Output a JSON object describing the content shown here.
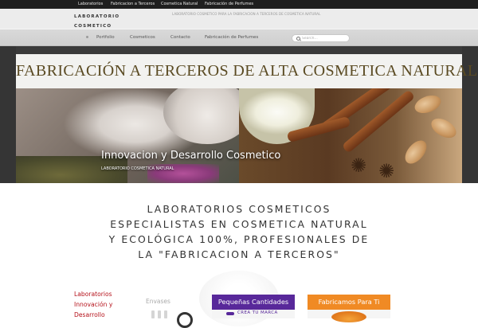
{
  "topbar": {
    "links": [
      "Laboratorios",
      "Fabricacion a Terceros",
      "Cosmetica Natural",
      "Fabricación de Perfumes"
    ]
  },
  "header": {
    "brand": "LABORATORIO COSMETICO",
    "tagline": "LABORATORIO COSMETICO PARA LA FABRICACION A TERCEROS DE COSMETICA NATURAL"
  },
  "nav": {
    "items": [
      "Portfolio",
      "Cosmeticos",
      "Contacto",
      "Fabricación de Perfumes"
    ],
    "search_placeholder": "Search..."
  },
  "hero": {
    "title": "FABRICACIÓN A TERCEROS DE ALTA COSMETICA NATURAL",
    "caption": "Innovacion y Desarrollo Cosmetico",
    "caption_sub": "LABORATORIO COSMETICA NATURAL"
  },
  "intro": {
    "lines": [
      "LABORATORIOS COSMETICOS",
      "ESPECIALISTAS EN COSMETICA NATURAL",
      "Y ECOLÓGICA 100%, PROFESIONALES DE",
      "LA \"FABRICACION A TERCEROS\""
    ]
  },
  "sidebar_links": [
    "Laboratorios",
    "Innovación y",
    "Desarrollo"
  ],
  "features": {
    "envases_label": "Envases",
    "cards": [
      {
        "title": "Pequeñas Cantidades",
        "subtitle": "CREA TU MARCA",
        "color": "#58289a"
      },
      {
        "title": "Fabricamos Para Ti",
        "color": "#f08a24"
      }
    ]
  },
  "colors": {
    "accent_red": "#b5121b",
    "topbar_bg": "#1f1f1f",
    "hero_title": "#5a4a22"
  }
}
